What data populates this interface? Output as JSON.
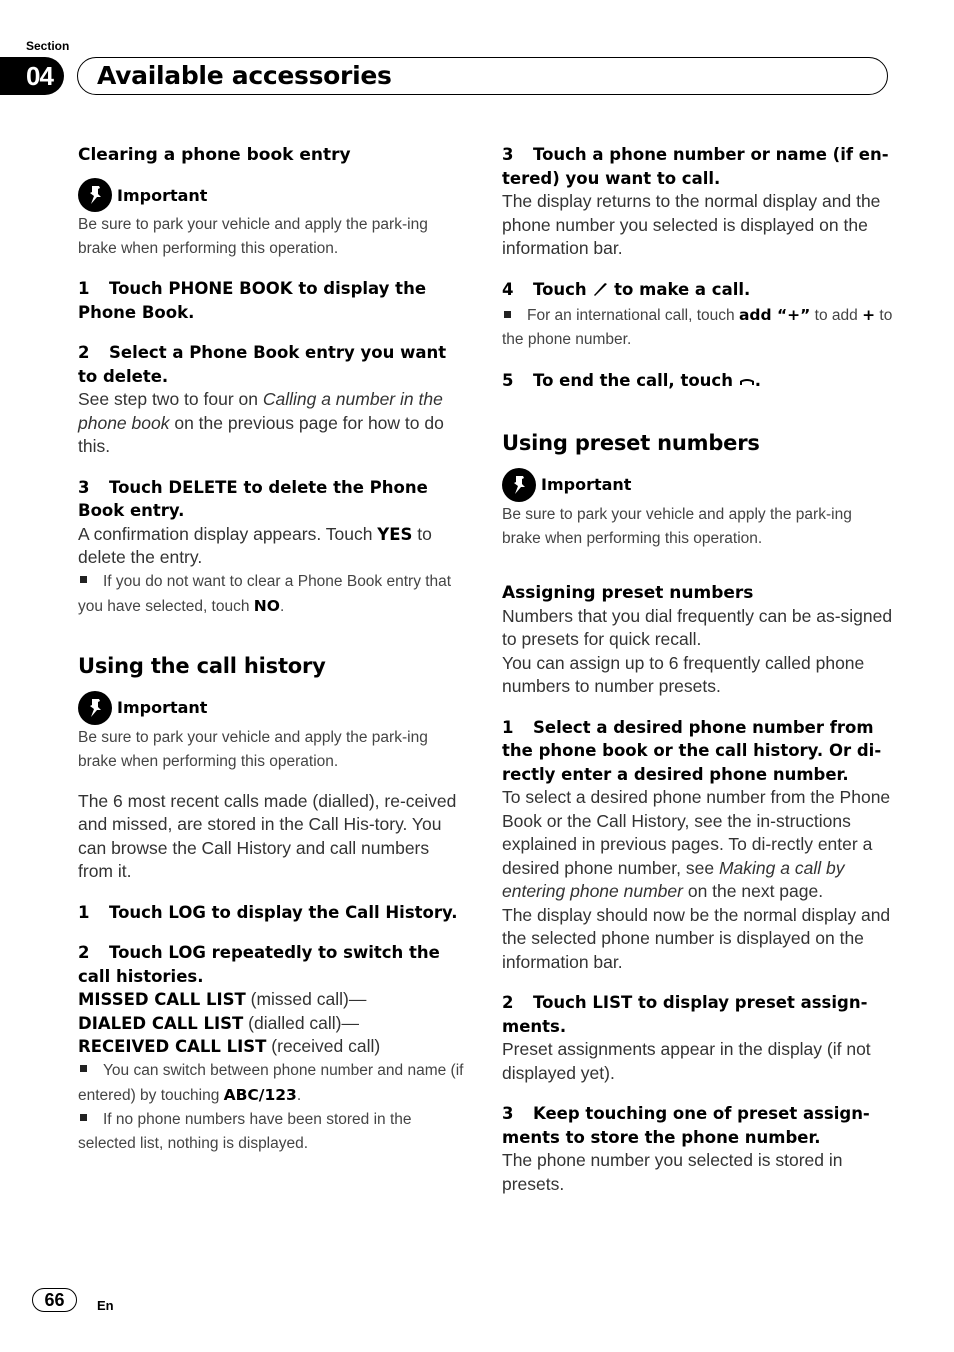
{
  "header": {
    "section_label": "Section",
    "section_number": "04",
    "title": "Available accessories"
  },
  "left": {
    "clearing": {
      "heading": "Clearing a phone book entry",
      "important_label": "Important",
      "important_text": "Be sure to park your vehicle and apply the park-ing brake when performing this operation.",
      "steps": [
        {
          "num": "1",
          "text": "Touch PHONE BOOK to display the Phone Book."
        },
        {
          "num": "2",
          "text": "Select a Phone Book entry you want to delete.",
          "body_pre": "See step two to four on ",
          "body_italic": "Calling a number in the phone book",
          "body_post": " on the previous page for how to do this."
        },
        {
          "num": "3",
          "text": "Touch DELETE to delete the Phone Book entry.",
          "body_pre": "A confirmation display appears. Touch ",
          "body_bold": "YES",
          "body_post": " to delete the entry.",
          "note_pre": "If you do not want to clear a Phone Book entry that you have selected, touch ",
          "note_bold": "NO",
          "note_post": "."
        }
      ]
    },
    "call_history": {
      "heading": "Using the call history",
      "important_label": "Important",
      "important_text": "Be sure to park your vehicle and apply the park-ing brake when performing this operation.",
      "intro": "The 6 most recent calls made (dialled), re-ceived and missed, are stored in the Call His-tory. You can browse the Call History and call numbers from it.",
      "steps": [
        {
          "num": "1",
          "text": "Touch LOG to display the Call History."
        },
        {
          "num": "2",
          "text": "Touch LOG repeatedly to switch the call histories."
        }
      ],
      "lists": [
        {
          "name": "MISSED CALL LIST",
          "desc": " (missed call)—"
        },
        {
          "name": "DIALED CALL LIST",
          "desc": " (dialled call)—"
        },
        {
          "name": "RECEIVED CALL LIST",
          "desc": " (received call)"
        }
      ],
      "notes": [
        {
          "pre": "You can switch between phone number and name (if entered) by touching ",
          "bold": "ABC/123",
          "post": "."
        },
        {
          "pre": "If no phone numbers have been stored in the selected list, nothing is displayed.",
          "bold": "",
          "post": ""
        }
      ]
    }
  },
  "right": {
    "steps_cont": [
      {
        "num": "3",
        "text": "Touch a phone number or name (if en-tered) you want to call.",
        "body": "The display returns to the normal display and the phone number you selected is displayed on the information bar."
      },
      {
        "num": "4",
        "text_pre": "Touch ",
        "icon": "phone-handset-icon",
        "text_post": " to make a call.",
        "note_pre": "For an international call, touch ",
        "note_bold": "add “+”",
        "note_mid": " to add ",
        "note_plus": "+",
        "note_post": " to the phone number."
      },
      {
        "num": "5",
        "text_pre": "To end the call, touch ",
        "icon": "hang-up-icon",
        "text_post": "."
      }
    ],
    "preset": {
      "heading": "Using preset numbers",
      "important_label": "Important",
      "important_text": "Be sure to park your vehicle and apply the park-ing brake when performing this operation.",
      "subheading": "Assigning preset numbers",
      "intro1": "Numbers that you dial frequently can be as-signed to presets for quick recall.",
      "intro2": "You can assign up to 6 frequently called phone numbers to number presets.",
      "steps": [
        {
          "num": "1",
          "text": "Select a desired phone number from the phone book or the call history. Or di-rectly enter a desired phone number.",
          "body_pre": "To select a desired phone number from the Phone Book or the Call History, see the in-structions explained in previous pages. To di-rectly enter a desired phone number, see ",
          "body_italic": "Making a call by entering phone number",
          "body_post": " on the next page.",
          "body2": "The display should now be the normal display and the selected phone number is displayed on the information bar."
        },
        {
          "num": "2",
          "text": "Touch LIST to display preset assign-ments.",
          "body": "Preset assignments appear in the display (if not displayed yet)."
        },
        {
          "num": "3",
          "text": "Keep touching one of preset assign-ments to store the phone number.",
          "body": "The phone number you selected is stored in presets."
        }
      ]
    }
  },
  "footer": {
    "page_number": "66",
    "language": "En"
  }
}
